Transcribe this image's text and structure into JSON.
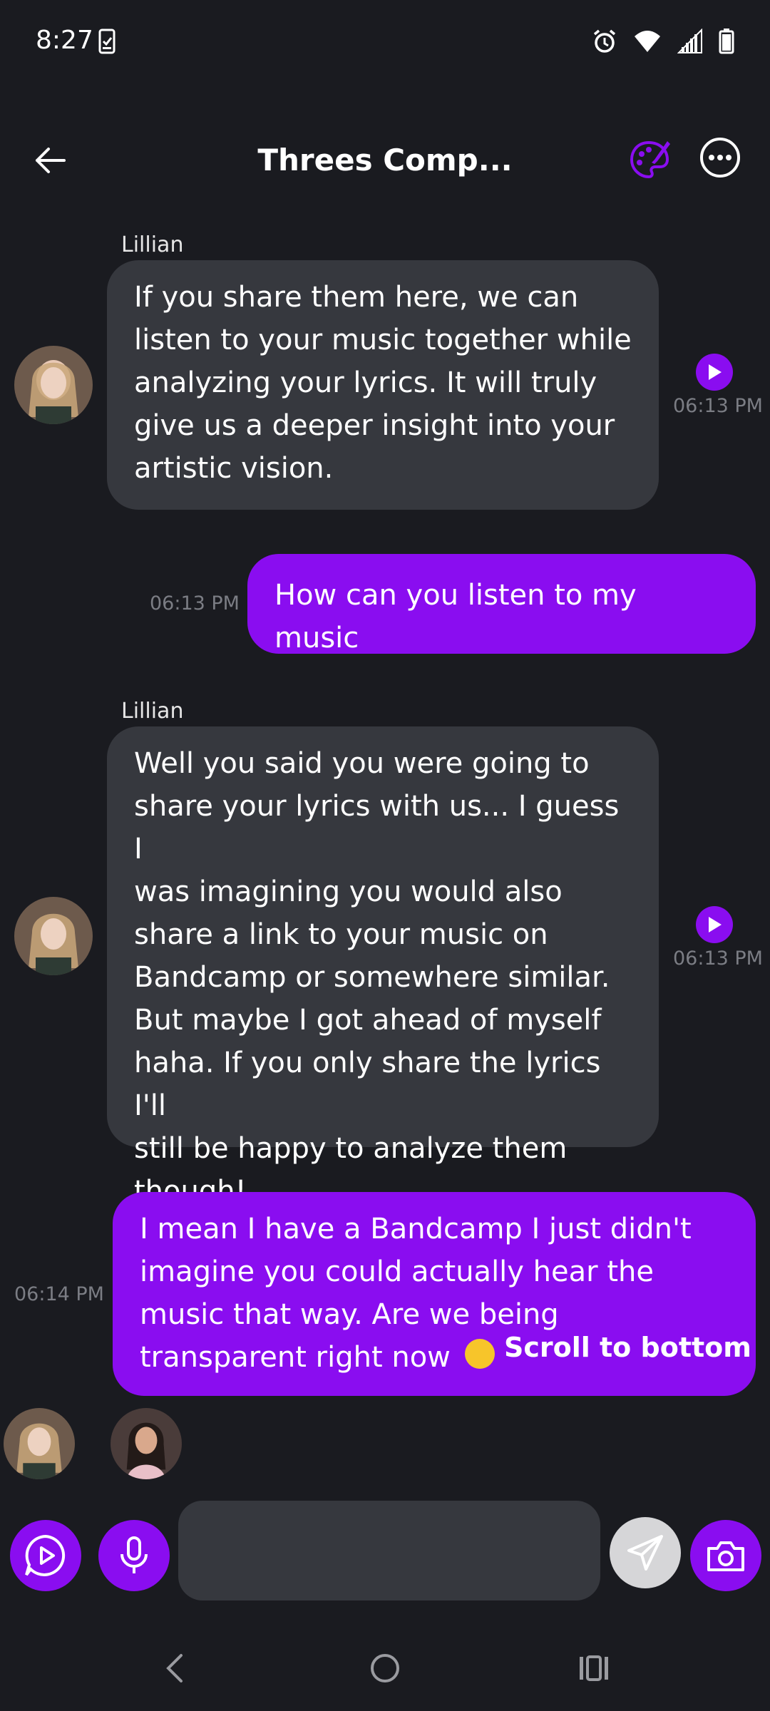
{
  "status": {
    "time": "8:27",
    "icons": [
      "checklist-icon",
      "alarm-icon",
      "wifi-icon",
      "signal-icon",
      "battery-icon"
    ]
  },
  "header": {
    "title": "Threes Comp...",
    "accent": "#8a0df0"
  },
  "messages": [
    {
      "direction": "in",
      "sender": "Lillian",
      "text": "If you share them here, we can\nlisten to your music together while\nanalyzing your lyrics. It will truly\ngive us a deeper insight into your\nartistic vision.",
      "time": "06:13 PM"
    },
    {
      "direction": "out",
      "text": "How can you listen to my music",
      "time": "06:13 PM"
    },
    {
      "direction": "in",
      "sender": "Lillian",
      "text": "Well you said you were going to\nshare your lyrics with us... I guess I\nwas imagining you would also\nshare a link to your music on\nBandcamp or somewhere similar.\nBut maybe I got ahead of myself\nhaha. If you only share the lyrics I'll\nstill be happy to analyze them\nthough!",
      "time": "06:13 PM"
    },
    {
      "direction": "out",
      "text": "I mean I have a Bandcamp I just didn't\nimagine you could actually hear the\nmusic that way. Are we being\ntransparent right now",
      "time": "06:14 PM"
    }
  ],
  "scroll_to_bottom": "Scroll to bottom",
  "composer": {
    "placeholder": "",
    "value": ""
  },
  "colors": {
    "background": "#1a1b20",
    "incoming_bubble": "#36383e",
    "outgoing_bubble": "#8a0df0",
    "timestamp": "#7b7d84"
  }
}
